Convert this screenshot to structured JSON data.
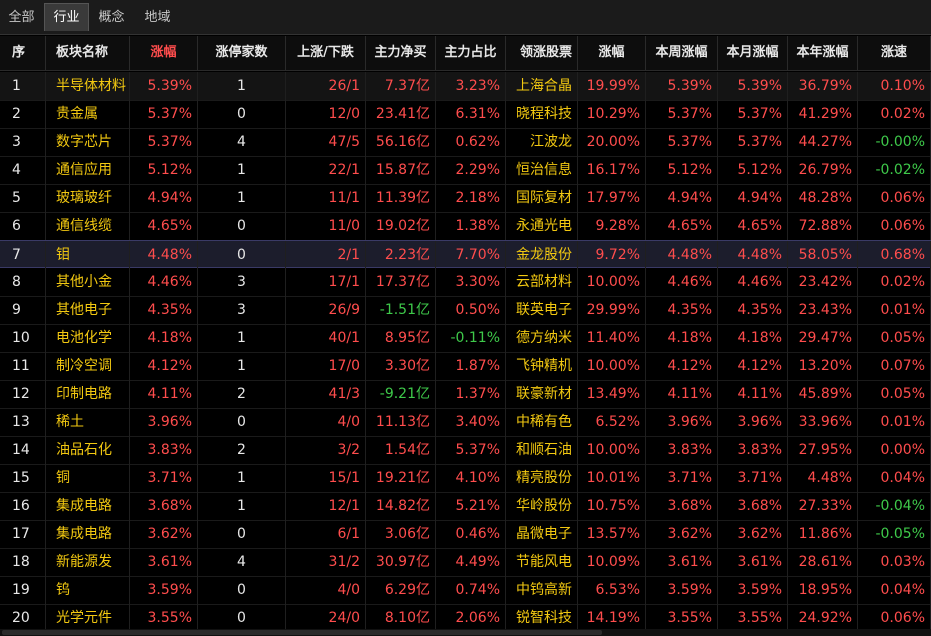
{
  "tabs": [
    {
      "label": "全部",
      "active": false
    },
    {
      "label": "行业",
      "active": true
    },
    {
      "label": "概念",
      "active": false
    },
    {
      "label": "地域",
      "active": false
    }
  ],
  "headers": [
    "序",
    "板块名称",
    "涨幅",
    "涨停家数",
    "上涨/下跌",
    "主力净买",
    "主力占比",
    "领涨股票",
    "涨幅",
    "本周涨幅",
    "本月涨幅",
    "本年涨幅",
    "涨速"
  ],
  "colors": {
    "red": "#ff4d4d",
    "green": "#3ec94a",
    "yellow": "#f2c811",
    "white": "#e8e8e8"
  },
  "rows": [
    [
      "1",
      "半导体材料",
      "5.39%",
      "1",
      "26/1",
      "7.37亿",
      "3.23%",
      "上海合晶",
      "19.99%",
      "5.39%",
      "5.39%",
      "36.79%",
      "0.10%"
    ],
    [
      "2",
      "贵金属",
      "5.37%",
      "0",
      "12/0",
      "23.41亿",
      "6.31%",
      "晓程科技",
      "10.29%",
      "5.37%",
      "5.37%",
      "41.29%",
      "0.02%"
    ],
    [
      "3",
      "数字芯片",
      "5.37%",
      "4",
      "47/5",
      "56.16亿",
      "0.62%",
      "江波龙",
      "20.00%",
      "5.37%",
      "5.37%",
      "44.27%",
      "-0.00%"
    ],
    [
      "4",
      "通信应用",
      "5.12%",
      "1",
      "22/1",
      "15.87亿",
      "2.29%",
      "恒治信息",
      "16.17%",
      "5.12%",
      "5.12%",
      "26.79%",
      "-0.02%"
    ],
    [
      "5",
      "玻璃玻纤",
      "4.94%",
      "1",
      "11/1",
      "11.39亿",
      "2.18%",
      "国际复材",
      "17.97%",
      "4.94%",
      "4.94%",
      "48.28%",
      "0.06%"
    ],
    [
      "6",
      "通信线缆",
      "4.65%",
      "0",
      "11/0",
      "19.02亿",
      "1.38%",
      "永通光电",
      "9.28%",
      "4.65%",
      "4.65%",
      "72.88%",
      "0.06%"
    ],
    [
      "7",
      "钼",
      "4.48%",
      "0",
      "2/1",
      "2.23亿",
      "7.70%",
      "金龙股份",
      "9.72%",
      "4.48%",
      "4.48%",
      "58.05%",
      "0.68%"
    ],
    [
      "8",
      "其他小金",
      "4.46%",
      "3",
      "17/1",
      "17.37亿",
      "3.30%",
      "云部材料",
      "10.00%",
      "4.46%",
      "4.46%",
      "23.42%",
      "0.02%"
    ],
    [
      "9",
      "其他电子",
      "4.35%",
      "3",
      "26/9",
      "-1.51亿",
      "0.50%",
      "联英电子",
      "29.99%",
      "4.35%",
      "4.35%",
      "23.43%",
      "0.01%"
    ],
    [
      "10",
      "电池化学",
      "4.18%",
      "1",
      "40/1",
      "8.95亿",
      "-0.11%",
      "德方纳米",
      "11.40%",
      "4.18%",
      "4.18%",
      "29.47%",
      "0.05%"
    ],
    [
      "11",
      "制冷空调",
      "4.12%",
      "1",
      "17/0",
      "3.30亿",
      "1.87%",
      "飞钟精机",
      "10.00%",
      "4.12%",
      "4.12%",
      "13.20%",
      "0.07%"
    ],
    [
      "12",
      "印制电路",
      "4.11%",
      "2",
      "41/3",
      "-9.21亿",
      "1.37%",
      "联豪新材",
      "13.49%",
      "4.11%",
      "4.11%",
      "45.89%",
      "0.05%"
    ],
    [
      "13",
      "稀土",
      "3.96%",
      "0",
      "4/0",
      "11.13亿",
      "3.40%",
      "中稀有色",
      "6.52%",
      "3.96%",
      "3.96%",
      "33.96%",
      "0.01%"
    ],
    [
      "14",
      "油品石化",
      "3.83%",
      "2",
      "3/2",
      "1.54亿",
      "5.37%",
      "和顺石油",
      "10.00%",
      "3.83%",
      "3.83%",
      "27.95%",
      "0.00%"
    ],
    [
      "15",
      "铜",
      "3.71%",
      "1",
      "15/1",
      "19.21亿",
      "4.10%",
      "精亮股份",
      "10.01%",
      "3.71%",
      "3.71%",
      "4.48%",
      "0.04%"
    ],
    [
      "16",
      "集成电路",
      "3.68%",
      "1",
      "12/1",
      "14.82亿",
      "5.21%",
      "华岭股份",
      "10.75%",
      "3.68%",
      "3.68%",
      "27.33%",
      "-0.04%"
    ],
    [
      "17",
      "集成电路",
      "3.62%",
      "0",
      "6/1",
      "3.06亿",
      "0.46%",
      "晶微电子",
      "13.57%",
      "3.62%",
      "3.62%",
      "11.86%",
      "-0.05%"
    ],
    [
      "18",
      "新能源发",
      "3.61%",
      "4",
      "31/2",
      "30.97亿",
      "4.49%",
      "节能风电",
      "10.09%",
      "3.61%",
      "3.61%",
      "28.61%",
      "0.03%"
    ],
    [
      "19",
      "钨",
      "3.59%",
      "0",
      "4/0",
      "6.29亿",
      "0.74%",
      "中钨高新",
      "6.53%",
      "3.59%",
      "3.59%",
      "18.95%",
      "0.04%"
    ],
    [
      "20",
      "光学元件",
      "3.55%",
      "0",
      "24/0",
      "8.10亿",
      "2.06%",
      "锐智科技",
      "14.19%",
      "3.55%",
      "3.55%",
      "24.92%",
      "0.06%"
    ]
  ]
}
